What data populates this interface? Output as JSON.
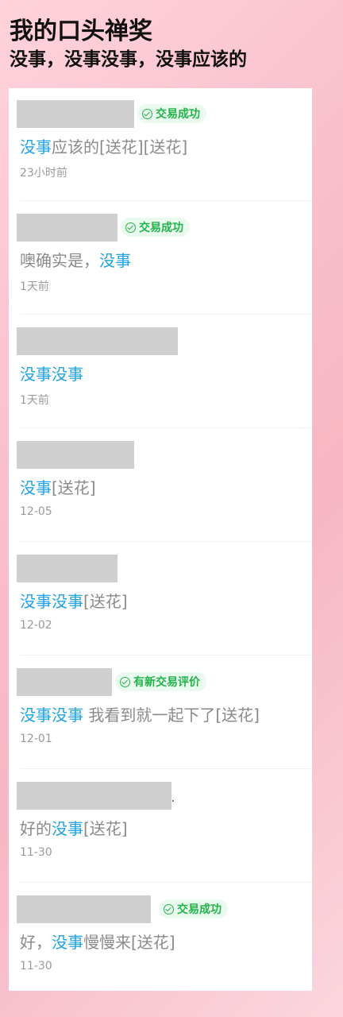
{
  "header": {
    "title": "我的口头禅奖",
    "subtitle": "没事，没事没事，没事应该的"
  },
  "items": [
    {
      "badge": "交易成功",
      "parts": [
        {
          "t": "没事",
          "hl": true
        },
        {
          "t": "应该的[送花][送花]",
          "hl": false
        }
      ],
      "time": "23小时前"
    },
    {
      "badge": "交易成功",
      "parts": [
        {
          "t": "噢确实是，",
          "hl": false
        },
        {
          "t": "没事",
          "hl": true
        }
      ],
      "time": "1天前"
    },
    {
      "badge": "",
      "parts": [
        {
          "t": "没事没事",
          "hl": true
        }
      ],
      "time": "1天前"
    },
    {
      "badge": "",
      "parts": [
        {
          "t": "没事",
          "hl": true
        },
        {
          "t": "[送花]",
          "hl": false
        }
      ],
      "time": "12-05"
    },
    {
      "badge": "",
      "parts": [
        {
          "t": "没事没事",
          "hl": true
        },
        {
          "t": "[送花]",
          "hl": false
        }
      ],
      "time": "12-02"
    },
    {
      "badge": "有新交易评价",
      "parts": [
        {
          "t": "没事没事",
          "hl": true
        },
        {
          "t": " 我看到就一起下了[送花]",
          "hl": false
        }
      ],
      "time": "12-01"
    },
    {
      "badge": "",
      "parts": [
        {
          "t": "好的",
          "hl": false
        },
        {
          "t": "没事",
          "hl": true
        },
        {
          "t": "[送花]",
          "hl": false
        }
      ],
      "time": "11-30"
    },
    {
      "badge": "交易成功",
      "parts": [
        {
          "t": "好，",
          "hl": false
        },
        {
          "t": "没事",
          "hl": true
        },
        {
          "t": "慢慢来[送花]",
          "hl": false
        }
      ],
      "time": "11-30"
    }
  ],
  "colors": {
    "highlight": "#1fa3e3",
    "badge_text": "#21b34a",
    "badge_bg": "#eafaee",
    "redact": "#cfcfcf"
  },
  "icons": {
    "badge": "check-circle-icon"
  }
}
